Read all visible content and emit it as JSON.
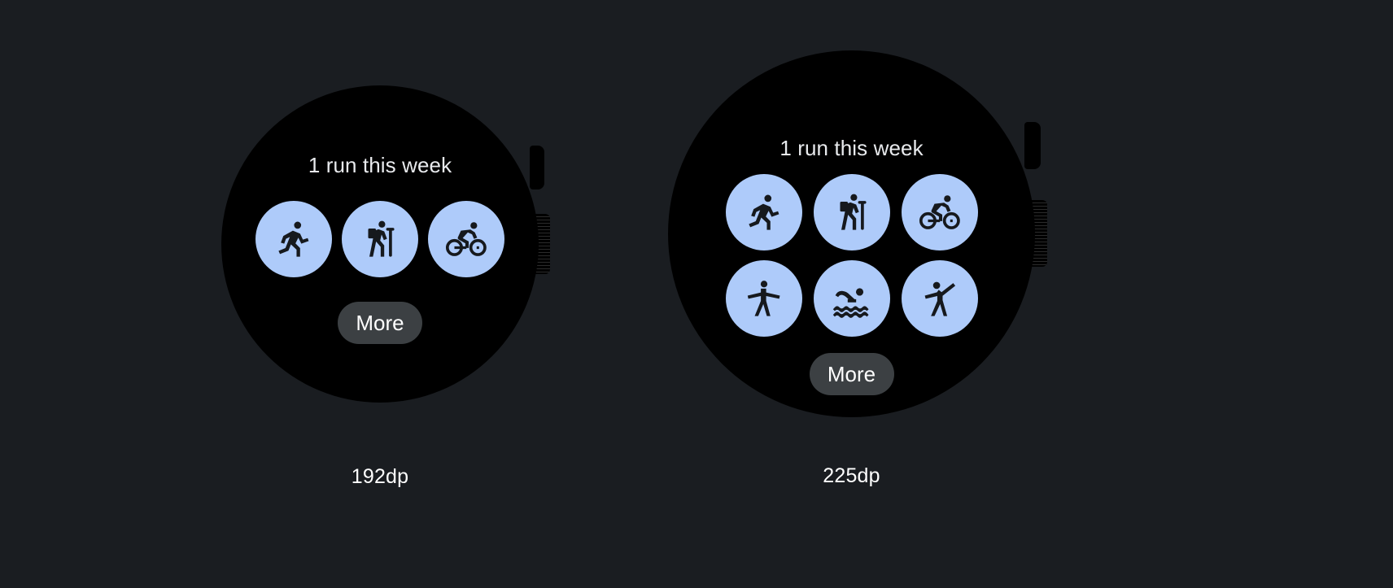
{
  "background_color": "#1a1d21",
  "accent_color": "#aecbfa",
  "surface_color": "#000000",
  "button_color": "#3c4043",
  "text_color": "#e8eaed",
  "devices": [
    {
      "id": "192dp",
      "size_label": "192dp",
      "headline": "1 run this week",
      "more_label": "More",
      "icons": [
        {
          "name": "running-icon",
          "label": "Run"
        },
        {
          "name": "hiking-icon",
          "label": "Hike"
        },
        {
          "name": "cycling-icon",
          "label": "Bike"
        }
      ]
    },
    {
      "id": "225dp",
      "size_label": "225dp",
      "headline": "1 run this week",
      "more_label": "More",
      "icons": [
        {
          "name": "running-icon",
          "label": "Run"
        },
        {
          "name": "hiking-icon",
          "label": "Hike"
        },
        {
          "name": "cycling-icon",
          "label": "Bike"
        },
        {
          "name": "stretching-icon",
          "label": "Stretch"
        },
        {
          "name": "swimming-icon",
          "label": "Swim"
        },
        {
          "name": "dancing-icon",
          "label": "Dance"
        }
      ]
    }
  ]
}
